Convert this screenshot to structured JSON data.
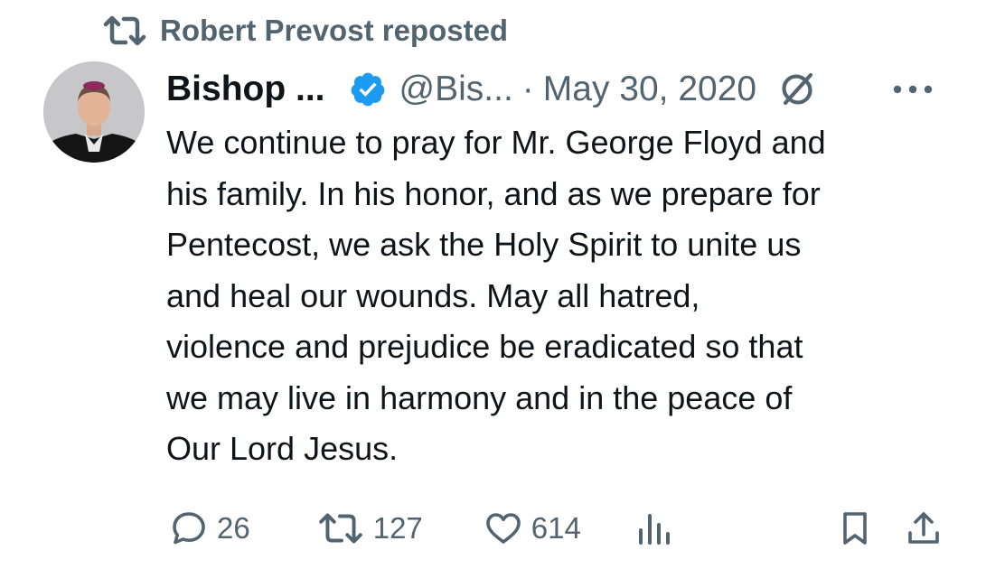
{
  "repost": {
    "label": "Robert Prevost reposted"
  },
  "author": {
    "name": "Bishop ...",
    "handle": "@Bis...",
    "separator": "·",
    "date": "May 30, 2020"
  },
  "tweet": {
    "lines": [
      "We continue to pray for Mr. George Floyd and",
      "his family. In his honor, and as we prepare for",
      "Pentecost, we ask the Holy Spirit to unite us",
      "and heal our wounds. May all hatred,",
      "violence and prejudice be eradicated so that",
      "we may live in harmony and in the peace of",
      "Our Lord Jesus."
    ]
  },
  "actions": {
    "replies": "26",
    "reposts": "127",
    "likes": "614"
  },
  "colors": {
    "text": "#0f1419",
    "secondary": "#536471",
    "verified": "#1d9bf0"
  }
}
